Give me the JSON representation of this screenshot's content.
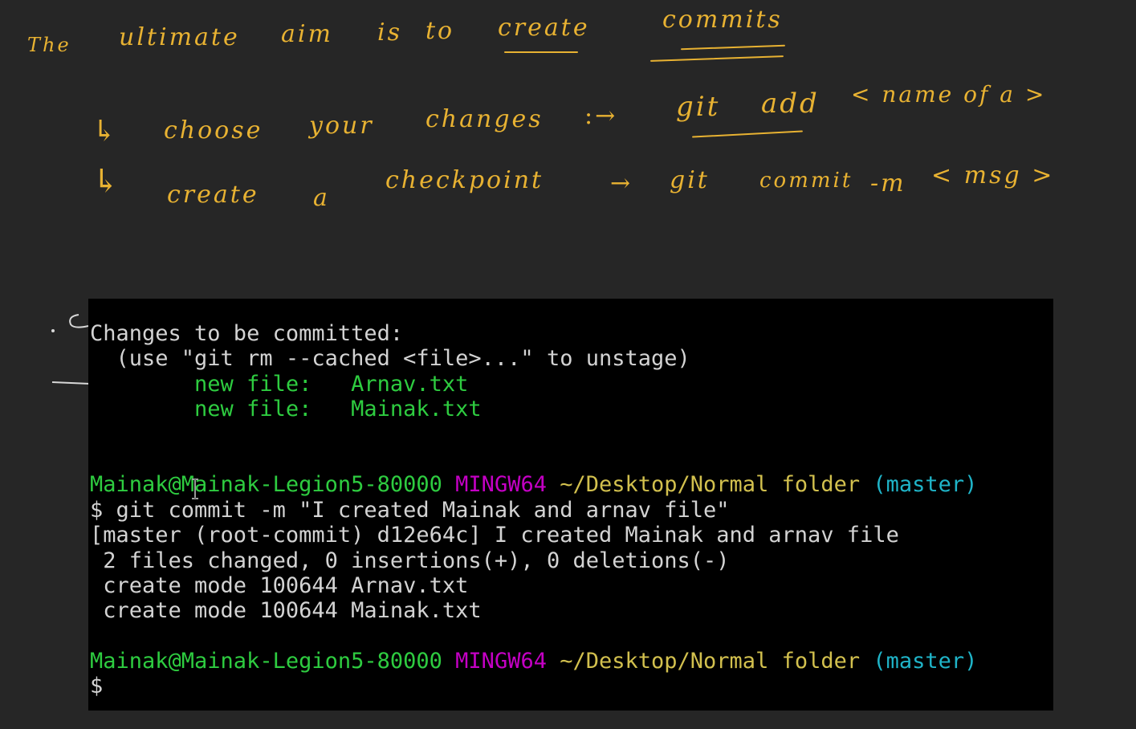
{
  "whiteboard": {
    "line1": {
      "w1": "The",
      "w2": "ultimate",
      "w3": "aim",
      "w4": "is",
      "w5": "to",
      "w6": "create",
      "w7": "commits"
    },
    "line2": {
      "bullet": "↳",
      "w1": "choose",
      "w2": "your",
      "w3": "changes",
      "arrow": ":→",
      "cmd1": "git",
      "cmd2": "add",
      "arg": "< name of a >"
    },
    "line3": {
      "bullet": "↳",
      "w1": "create",
      "w2": "a",
      "w3": "checkpoint",
      "arrow": "→",
      "cmd1": "git",
      "cmd2": "commit",
      "cmd3": "-m",
      "arg": "< msg >"
    },
    "stray": "c"
  },
  "terminal": {
    "status_header": "Changes to be committed:",
    "unstage_hint": "  (use \"git rm --cached <file>...\" to unstage)",
    "staged": [
      {
        "label": "        new file:   ",
        "file": "Arnav.txt"
      },
      {
        "label": "        new file:   ",
        "file": "Mainak.txt"
      }
    ],
    "prompt1": {
      "user_host": "Mainak@Mainak-Legion5-80000",
      "system": "MINGW64",
      "path": "~/Desktop/Normal folder",
      "branch": "(master)"
    },
    "command": "$ git commit -m \"I created Mainak and arnav file\"",
    "output": [
      "[master (root-commit) d12e64c] I created Mainak and arnav file",
      " 2 files changed, 0 insertions(+), 0 deletions(-)",
      " create mode 100644 Arnav.txt",
      " create mode 100644 Mainak.txt"
    ],
    "prompt2": {
      "user_host": "Mainak@Mainak-Legion5-80000",
      "system": "MINGW64",
      "path": "~/Desktop/Normal folder",
      "branch": "(master)"
    },
    "input_line": "$"
  },
  "colors": {
    "board_bg": "#262626",
    "ink": "#e8b232",
    "terminal_bg": "#000000",
    "prompt_green": "#2ecc40",
    "prompt_magenta": "#c400c4",
    "prompt_yellow": "#d2c04e",
    "prompt_cyan": "#1fb4c8"
  }
}
